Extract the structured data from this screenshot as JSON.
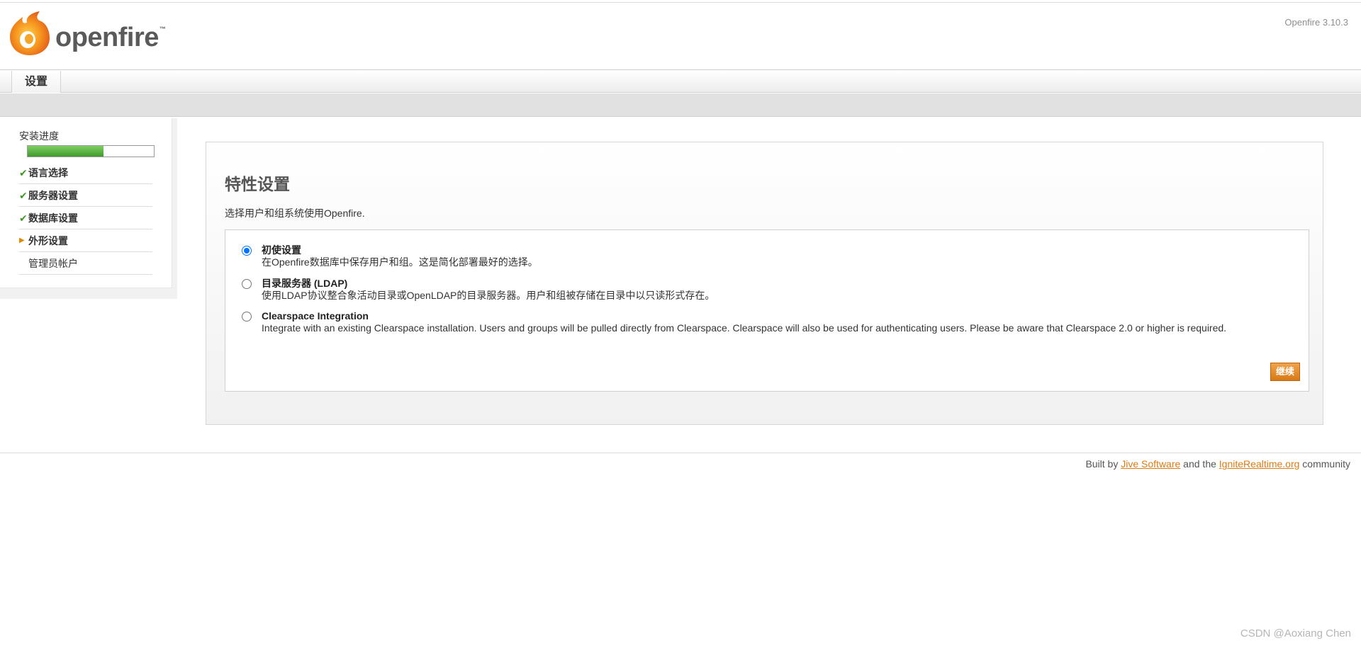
{
  "header": {
    "logo_text": "openfire",
    "logo_tm": "™",
    "version": "Openfire 3.10.3"
  },
  "tabs": [
    {
      "label": "设置"
    }
  ],
  "sidebar": {
    "progress_label": "安装进度",
    "progress_fraction": 0.6,
    "steps": [
      {
        "label": "语言选择",
        "status": "done"
      },
      {
        "label": "服务器设置",
        "status": "done"
      },
      {
        "label": "数据库设置",
        "status": "done"
      },
      {
        "label": "外形设置",
        "status": "current"
      },
      {
        "label": "管理员帐户",
        "status": "pending"
      }
    ]
  },
  "main": {
    "title": "特性设置",
    "intro": "选择用户和组系统使用Openfire.",
    "options": [
      {
        "title": "初使设置",
        "description": "在Openfire数据库中保存用户和组。这是简化部署最好的选择。",
        "selected": true
      },
      {
        "title": "目录服务器 (LDAP)",
        "description": "使用LDAP协议整合象活动目录或OpenLDAP的目录服务器。用户和组被存储在目录中以只读形式存在。",
        "selected": false
      },
      {
        "title": "Clearspace Integration",
        "description": "Integrate with an existing Clearspace installation. Users and groups will be pulled directly from Clearspace. Clearspace will also be used for authenticating users. Please be aware that Clearspace 2.0 or higher is required.",
        "selected": false
      }
    ],
    "continue_label": "继续"
  },
  "footer": {
    "prefix": "Built by ",
    "link1": "Jive Software",
    "middle": " and the ",
    "link2": "IgniteRealtime.org",
    "suffix": " community"
  },
  "watermark": "CSDN @Aoxiang Chen",
  "colors": {
    "accent_orange": "#e07b12",
    "progress_green": "#3f9a2b",
    "check_green": "#3f9a2b",
    "radio_blue": "#0075ff"
  },
  "icons": {
    "logo": "openfire-flame-icon",
    "step_done": "checkmark-icon",
    "step_current": "triangle-right-icon"
  }
}
